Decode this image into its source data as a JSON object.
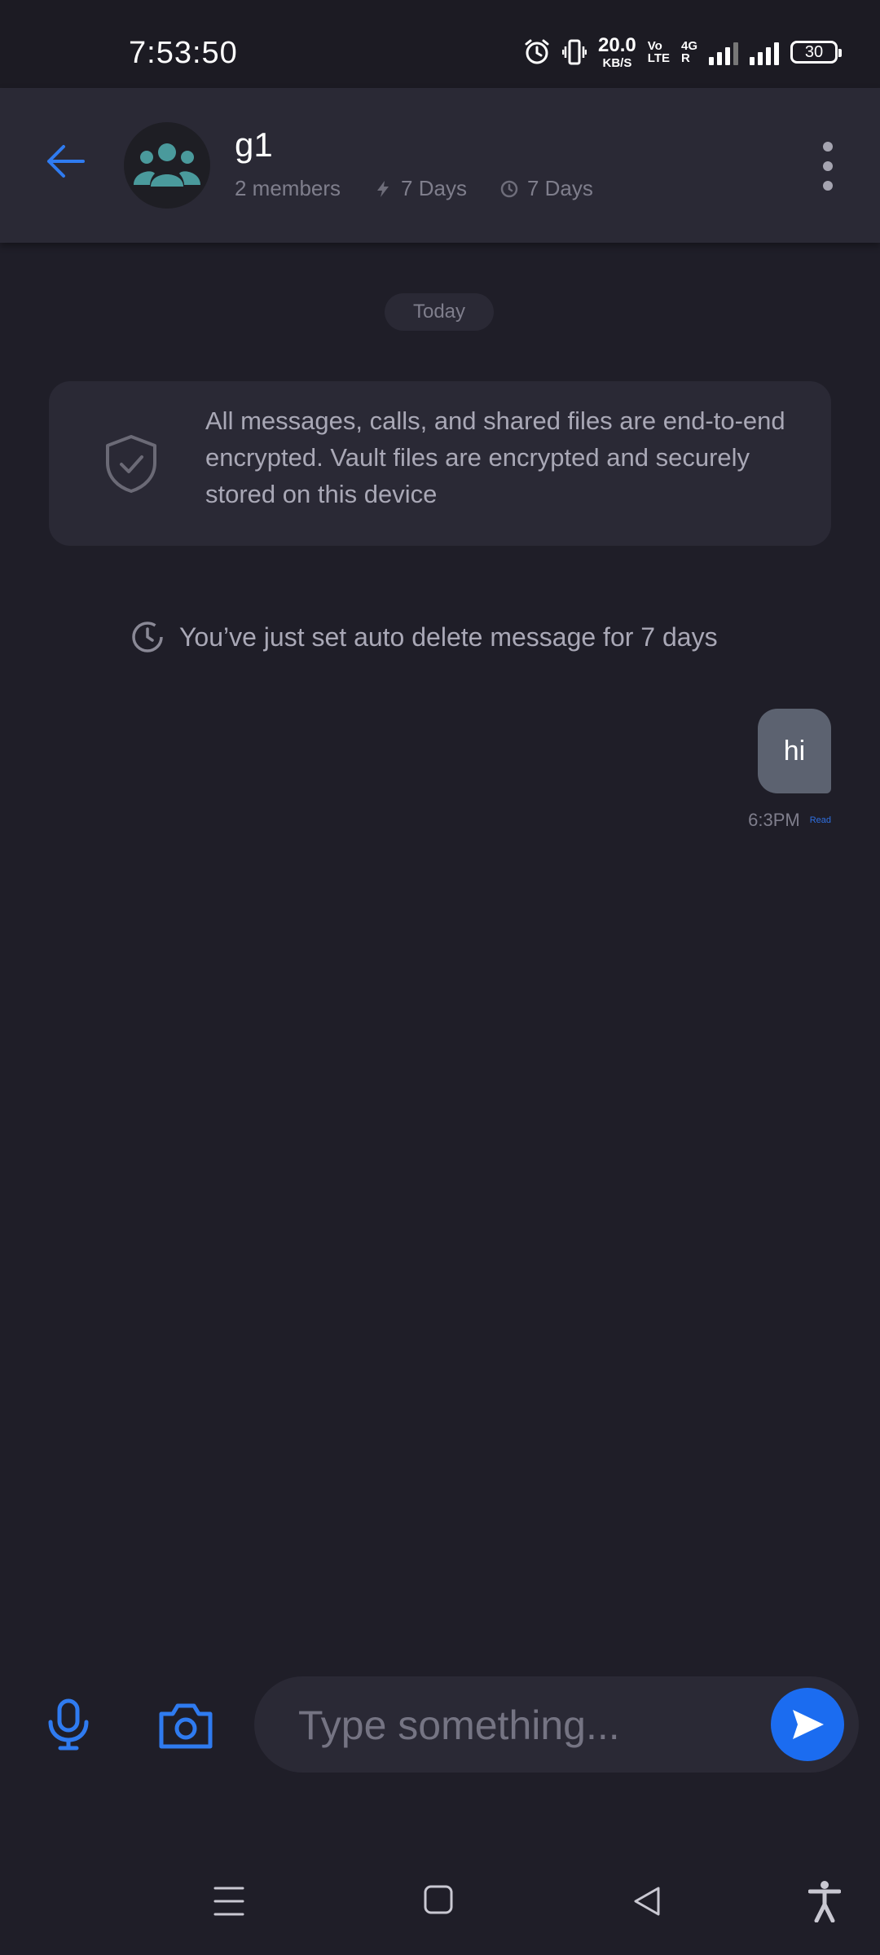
{
  "status_bar": {
    "time": "7:53:50",
    "net_speed_value": "20.0",
    "net_speed_unit": "KB/S",
    "volte_top": "Vo",
    "volte_bottom": "LTE",
    "network_top": "4G",
    "network_bottom": "R",
    "battery": "30"
  },
  "header": {
    "title": "g1",
    "members": "2 members",
    "disappearing_timer": "7 Days",
    "auto_delete_timer": "7 Days"
  },
  "chat": {
    "date_chip": "Today",
    "encryption_notice": "All messages, calls, and shared files are end-to-end encrypted. Vault files are encrypted and securely stored on this device",
    "auto_delete_notice": "You’ve just set auto delete message for 7 days",
    "messages": [
      {
        "text": "hi",
        "time": "6:3PM",
        "status": "Read"
      }
    ]
  },
  "composer": {
    "placeholder": "Type something..."
  },
  "colors": {
    "accent": "#1b6cf0",
    "background": "#1f1e28",
    "surface": "#2a2935",
    "bubble": "#5c6270",
    "avatar_icon": "#4a9a9c"
  },
  "icons": {
    "back": "arrow-left-icon",
    "group": "group-icon",
    "menu": "more-vertical-icon",
    "shield": "shield-check-icon",
    "timer": "timer-icon",
    "mic": "microphone-icon",
    "camera": "camera-icon",
    "send": "send-icon"
  }
}
